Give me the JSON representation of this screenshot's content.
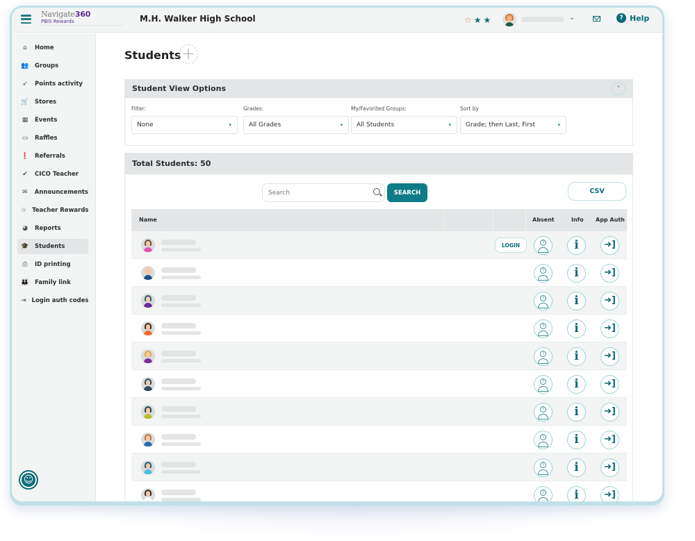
{
  "app": {
    "brand_name": "Navigate",
    "brand_number": "360",
    "brand_subtitle": "PBIS Rewards",
    "school_name": "M.H. Walker High School"
  },
  "header": {
    "stars": [
      "☆",
      "★",
      "★"
    ],
    "help_label": "Help",
    "help_icon_glyph": "?",
    "user_menu_caret": "⌄",
    "accent_color": "#0e6b78"
  },
  "sidebar": {
    "items": [
      {
        "label": "Home",
        "icon": "home-icon",
        "glyph": "⌂"
      },
      {
        "label": "Groups",
        "icon": "groups-icon",
        "glyph": "👥"
      },
      {
        "label": "Points activity",
        "icon": "rocket-icon",
        "glyph": "➶"
      },
      {
        "label": "Stores",
        "icon": "cart-icon",
        "glyph": "🛒"
      },
      {
        "label": "Events",
        "icon": "calendar-icon",
        "glyph": "▦"
      },
      {
        "label": "Raffles",
        "icon": "ticket-icon",
        "glyph": "▭"
      },
      {
        "label": "Referrals",
        "icon": "alert-icon",
        "glyph": "❗"
      },
      {
        "label": "CICO Teacher",
        "icon": "check-circle-icon",
        "glyph": "✔"
      },
      {
        "label": "Announcements",
        "icon": "envelope-icon",
        "glyph": "✉"
      },
      {
        "label": "Teacher Rewards",
        "icon": "star-outline-icon",
        "glyph": "☆"
      },
      {
        "label": "Reports",
        "icon": "pie-chart-icon",
        "glyph": "◕"
      },
      {
        "label": "Students",
        "icon": "graduation-cap-icon",
        "glyph": "🎓",
        "active": true
      },
      {
        "label": "ID printing",
        "icon": "printer-icon",
        "glyph": "⎙"
      },
      {
        "label": "Family link",
        "icon": "family-icon",
        "glyph": "👪"
      },
      {
        "label": "Login auth codes",
        "icon": "login-icon",
        "glyph": "⇥"
      }
    ],
    "accessibility_glyph": "☺"
  },
  "page": {
    "title": "Students",
    "add_glyph": "+"
  },
  "view_options": {
    "title": "Student View Options",
    "collapse_glyph": "˄",
    "filters": [
      {
        "label": "Filter:",
        "value": "None"
      },
      {
        "label": "Grades:",
        "value": "All Grades"
      },
      {
        "label": "My/Favorited Groups:",
        "value": "All Students"
      },
      {
        "label": "Sort by",
        "value": "Grade; then Last, First"
      }
    ],
    "caret_glyph": "▾"
  },
  "students": {
    "total_label": "Total Students: 50",
    "search_placeholder": "Search",
    "search_value": "",
    "search_button": "SEARCH",
    "csv_button": "CSV",
    "columns": {
      "name": "Name",
      "absent": "Absent",
      "info": "Info",
      "app_auth": "App Auth"
    },
    "login_button": "LOGIN",
    "info_glyph": "i",
    "auth_glyph": "➜]",
    "absent_glyph": "?",
    "rows": [
      {
        "hair": "#6b4a33",
        "shirt": "#e84fb0",
        "login": true
      },
      {
        "hair": "#f2c9a7",
        "shirt": "#1f4f86",
        "login": false
      },
      {
        "hair": "#2e5c79",
        "shirt": "#6a2a9a",
        "login": false
      },
      {
        "hair": "#3a2b24",
        "shirt": "#f26a2b",
        "login": false
      },
      {
        "hair": "#e0a93a",
        "shirt": "#7a2f95",
        "login": false
      },
      {
        "hair": "#2e4a5c",
        "shirt": "#2e4a5c",
        "login": false
      },
      {
        "hair": "#1f3f4f",
        "shirt": "#b8c02a",
        "login": false
      },
      {
        "hair": "#c0703a",
        "shirt": "#2a6ab0",
        "login": false
      },
      {
        "hair": "#1f5f6f",
        "shirt": "#4fc0dc",
        "login": false
      },
      {
        "hair": "#3a2b24",
        "shirt": "#ffffff",
        "login": false
      }
    ]
  }
}
